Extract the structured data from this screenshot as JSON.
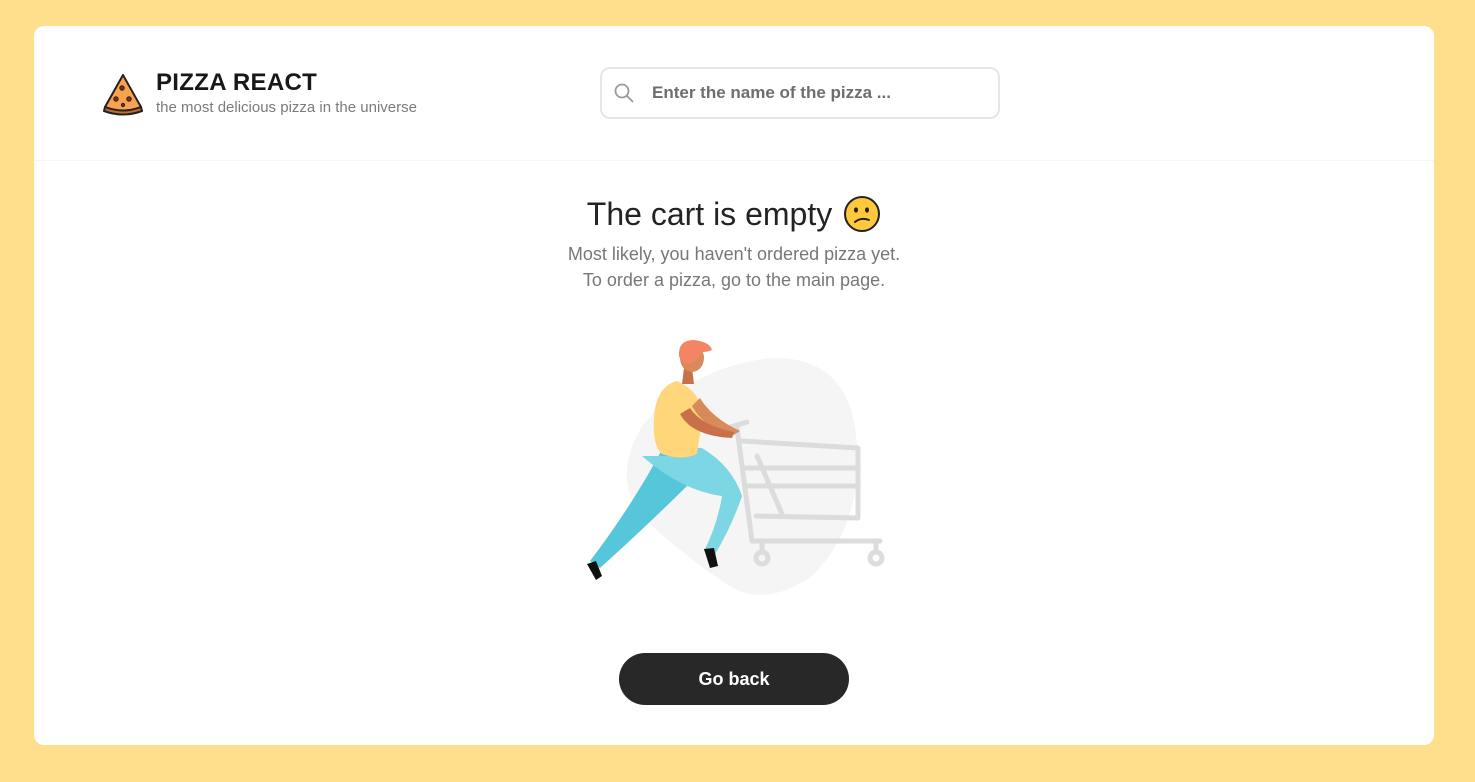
{
  "header": {
    "logo_title": "PIZZA REACT",
    "logo_subtitle": "the most delicious pizza in the universe",
    "logo_icon": "pizza-slice-icon"
  },
  "search": {
    "placeholder": "Enter the name of the pizza ...",
    "value": "",
    "icon": "search-icon"
  },
  "cart": {
    "title": "The cart is empty",
    "title_icon": "confused-face-icon",
    "line1": "Most likely, you haven't ordered pizza yet.",
    "line2": "To order a pizza, go to the main page.",
    "illustration": "shopping-cart-illustration"
  },
  "actions": {
    "go_back_label": "Go back"
  },
  "colors": {
    "page_background": "#ffdf8c",
    "card_background": "#ffffff",
    "button_background": "#282828",
    "text_dark": "#232323",
    "text_muted": "#777777"
  }
}
